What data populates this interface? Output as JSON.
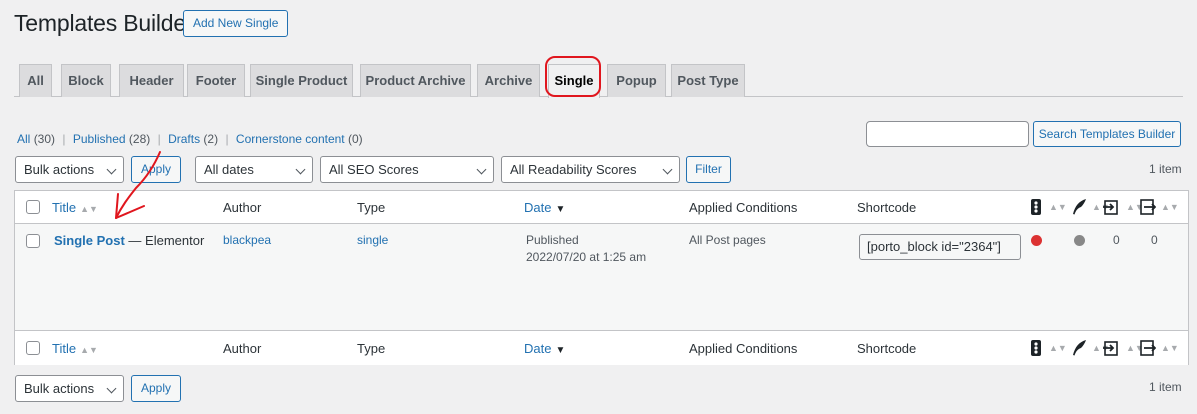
{
  "page": {
    "title": "Templates Builder",
    "add_new_label": "Add New Single"
  },
  "tabs": [
    "All",
    "Block",
    "Header",
    "Footer",
    "Single Product",
    "Product Archive",
    "Archive",
    "Single",
    "Popup",
    "Post Type"
  ],
  "active_tab": "Single",
  "views": {
    "all": "All",
    "all_count": "(30)",
    "published": "Published",
    "published_count": "(28)",
    "drafts": "Drafts",
    "drafts_count": "(2)",
    "cornerstone": "Cornerstone content",
    "cornerstone_count": "(0)",
    "separator": "|"
  },
  "search": {
    "value": "",
    "button_label": "Search Templates Builder"
  },
  "filters": {
    "bulk_actions": "Bulk actions",
    "apply": "Apply",
    "dates": "All dates",
    "seo": "All SEO Scores",
    "readability": "All Readability Scores",
    "filter": "Filter",
    "items_count": "1 item"
  },
  "columns": {
    "title": "Title",
    "author": "Author",
    "type": "Type",
    "date": "Date",
    "conditions": "Applied Conditions",
    "shortcode": "Shortcode"
  },
  "row": {
    "title": "Single Post",
    "title_suffix": "— Elementor",
    "author": "blackpea",
    "type": "single",
    "date_status": "Published",
    "date_value": "2022/07/20 at 1:25 am",
    "conditions": "All Post pages",
    "shortcode": "[porto_block id=\"2364\"]",
    "seo_color": "#dc3232",
    "readability_color": "#888888",
    "outgoing_links": "0",
    "incoming_links": "0"
  },
  "bottom": {
    "bulk_actions": "Bulk actions",
    "apply": "Apply",
    "items_count": "1 item"
  },
  "icons": {
    "seo": "traffic-light-icon",
    "readability": "quill-icon",
    "outgoing": "outgoing-links-icon",
    "incoming": "incoming-links-icon"
  },
  "colors": {
    "accent": "#2271b1",
    "annotation": "#e0161e"
  }
}
